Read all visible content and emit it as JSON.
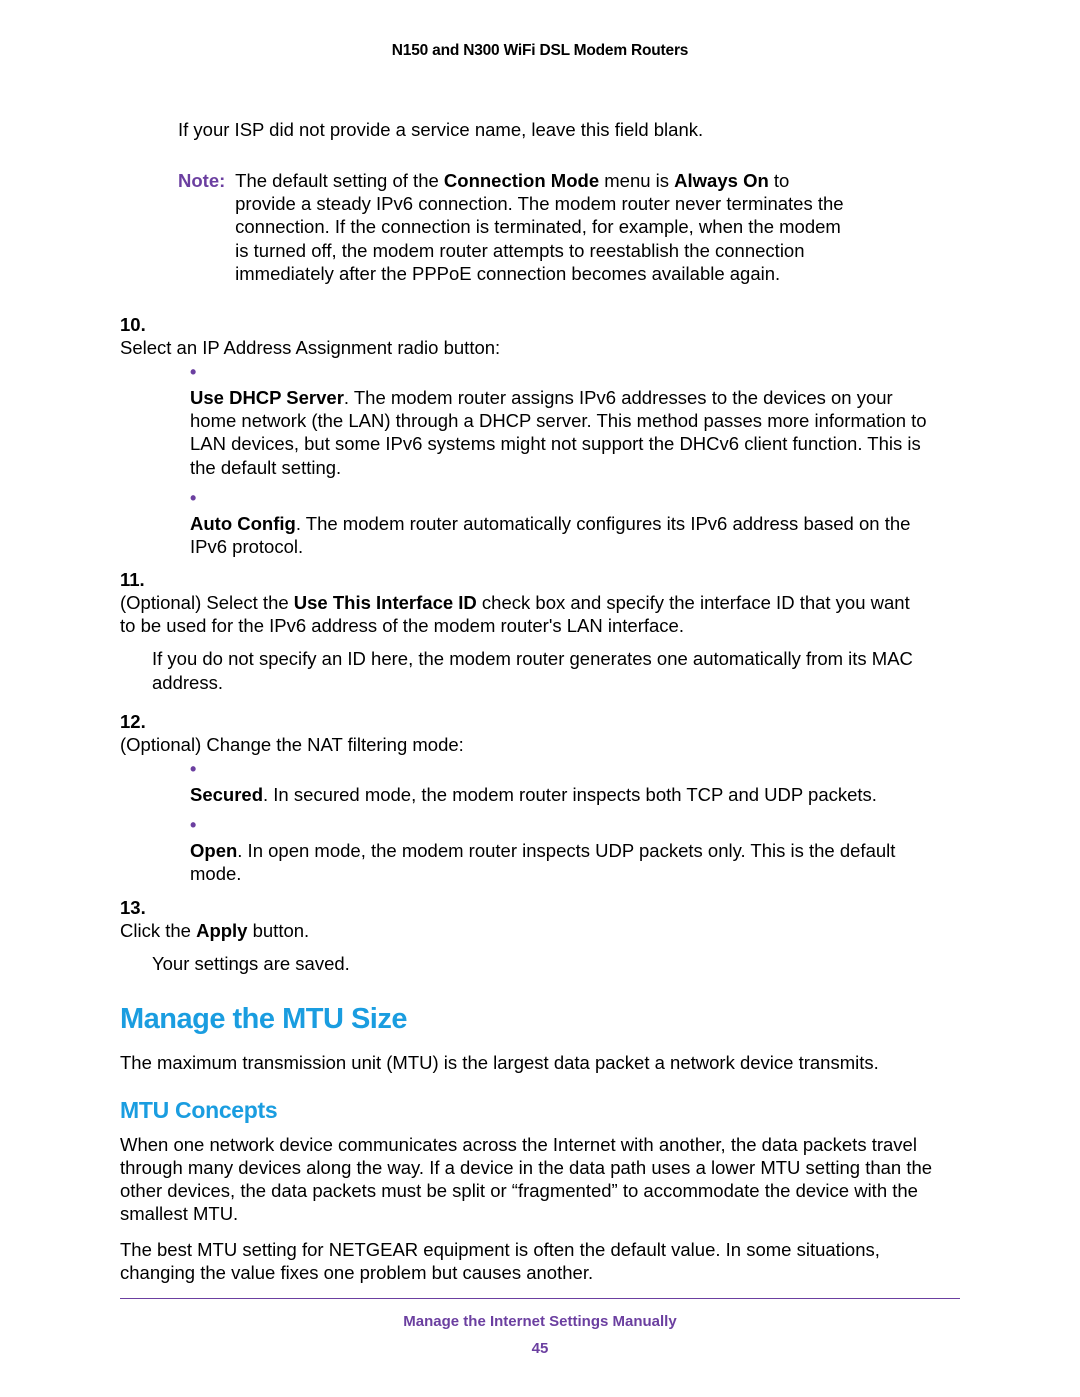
{
  "header": {
    "title": "N150 and N300 WiFi DSL Modem Routers"
  },
  "intro": {
    "isp_blank": "If your ISP did not provide a service name, leave this field blank."
  },
  "note": {
    "label": "Note:",
    "pre": "The default setting of the ",
    "conn_mode": "Connection Mode",
    "mid": " menu is ",
    "always_on": "Always On",
    "post": " to provide a steady IPv6 connection. The modem router never terminates the connection. If the connection is terminated, for example, when the modem is turned off, the modem router attempts to reestablish the connection immediately after the PPPoE connection becomes available again."
  },
  "steps": {
    "s10": {
      "num": "10.",
      "text": "Select an IP Address Assignment radio button:",
      "bullets": [
        {
          "term": "Use DHCP Server",
          "rest": ". The modem router assigns IPv6 addresses to the devices on your home network (the LAN) through a DHCP server. This method passes more information to LAN devices, but some IPv6 systems might not support the DHCv6 client function. This is the default setting."
        },
        {
          "term": "Auto Config",
          "rest": ". The modem router automatically configures its IPv6 address based on the IPv6 protocol."
        }
      ]
    },
    "s11": {
      "num": "11.",
      "pre": "(Optional) Select the ",
      "bold": "Use This Interface ID",
      "post": " check box and specify the interface ID that you want to be used for the IPv6 address of the modem router's LAN interface.",
      "follow": "If you do not specify an ID here, the modem router generates one automatically from its MAC address."
    },
    "s12": {
      "num": "12.",
      "text": "(Optional) Change the NAT filtering mode:",
      "bullets": [
        {
          "term": "Secured",
          "rest": ". In secured mode, the modem router inspects both TCP and UDP packets."
        },
        {
          "term": "Open",
          "rest": ". In open mode, the modem router inspects UDP packets only. This is the default mode."
        }
      ]
    },
    "s13": {
      "num": "13.",
      "pre": "Click the ",
      "bold": "Apply",
      "post": " button.",
      "follow": "Your settings are saved."
    }
  },
  "mtu": {
    "h1": "Manage the MTU Size",
    "intro": "The maximum transmission unit (MTU) is the largest data packet a network device transmits.",
    "h2": "MTU Concepts",
    "p1": "When one network device communicates across the Internet with another, the data packets travel through many devices along the way. If a device in the data path uses a lower MTU setting than the other devices, the data packets must be split or “fragmented” to accommodate the device with the smallest MTU.",
    "p2": "The best MTU setting for NETGEAR equipment is often the default value. In some situations, changing the value fixes one problem but causes another."
  },
  "footer": {
    "section": "Manage the Internet Settings Manually",
    "page": "45"
  }
}
